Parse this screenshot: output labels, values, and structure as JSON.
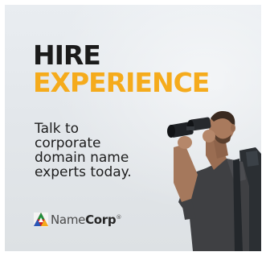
{
  "ad": {
    "headline_line1": "HIRE",
    "headline_line2": "EXPERIENCE",
    "tagline_lines": [
      "Talk to",
      "corporate",
      "domain name",
      "experts today."
    ],
    "brand": {
      "name_part1": "Name",
      "name_part2": "Corp",
      "mark": "®"
    },
    "colors": {
      "headline_dark": "#1b1b1b",
      "headline_accent": "#f5ab1c",
      "background": "#e5e9ed"
    },
    "image": "man-with-binoculars"
  }
}
